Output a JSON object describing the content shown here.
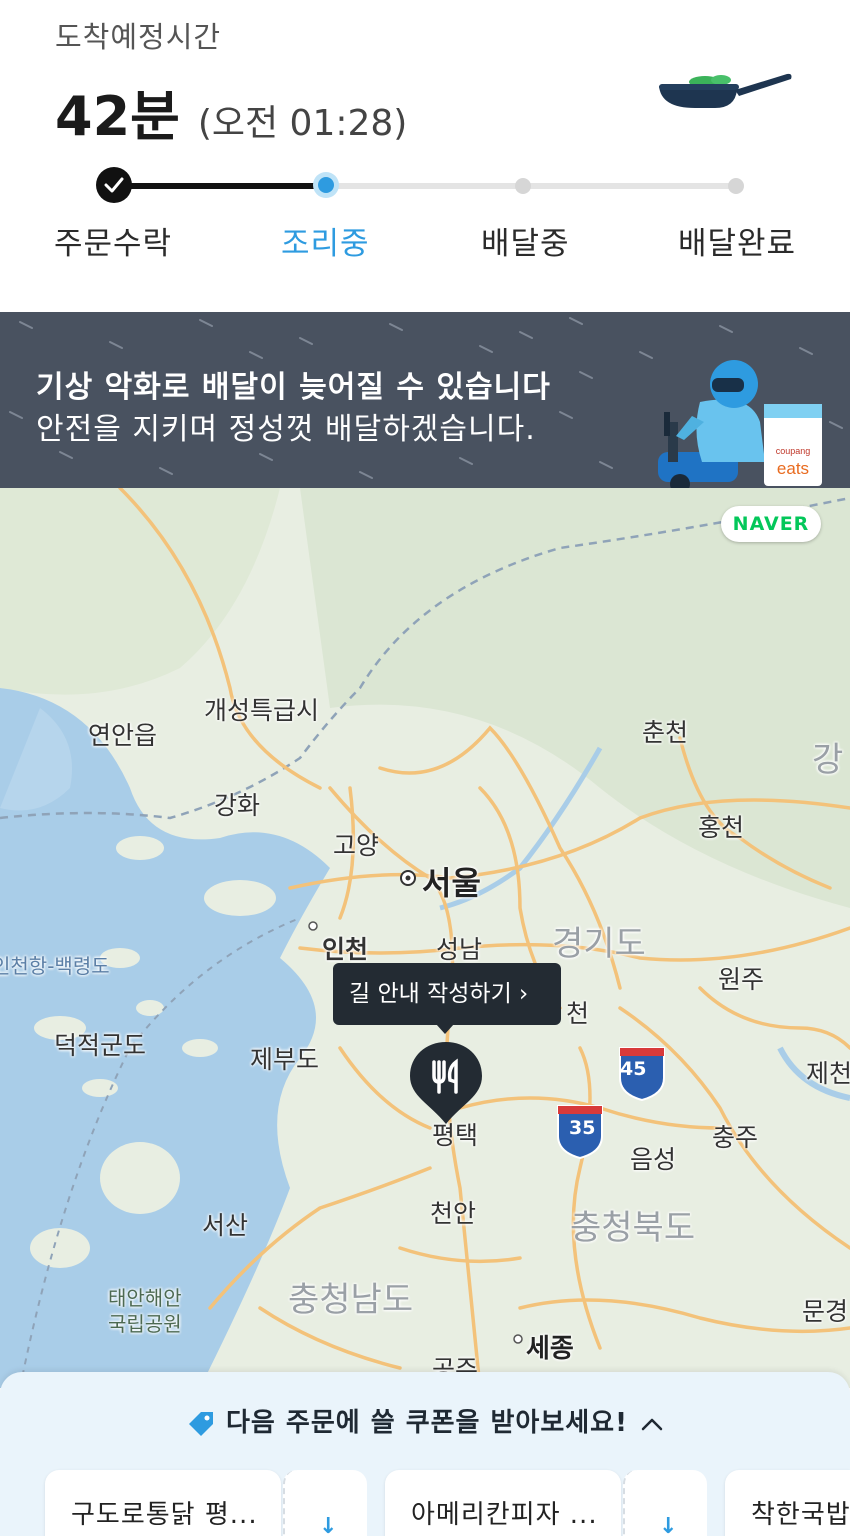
{
  "header": {
    "eta_label": "도착예정시간",
    "eta_minutes": "42분",
    "eta_clock": "(오전 01:28)"
  },
  "steps": [
    {
      "label": "주문수락",
      "state": "done"
    },
    {
      "label": "조리중",
      "state": "active"
    },
    {
      "label": "배달중",
      "state": "todo"
    },
    {
      "label": "배달완료",
      "state": "todo"
    }
  ],
  "banner": {
    "title": "기상 악화로 배달이 늦어질 수 있습니다",
    "subtitle": "안전을 지키며 정성껏 배달하겠습니다.",
    "logo_top": "coupang",
    "logo_bottom": "eats"
  },
  "map": {
    "provider_badge": "NAVER",
    "labels": {
      "gaesong": "개성특급시",
      "yeonan": "연안읍",
      "chuncheon": "춘천",
      "gang_edge": "강",
      "ganghwa": "강화",
      "hongcheon": "홍천",
      "goyang": "고양",
      "seoul": "서울",
      "incheon": "인천",
      "seongnam": "성남",
      "gyeonggi": "경기도",
      "wonju": "원주",
      "baengnyeong": "인천항-백령도",
      "cheon_partial": "천",
      "deokjeok": "덕적군도",
      "jebu": "제부도",
      "jecheon": "제천",
      "pyeongtaek": "평택",
      "chungju": "충주",
      "eumseong": "음성",
      "cheonan": "천안",
      "seosan": "서산",
      "chungbuk": "충청북도",
      "taean": "태안해안",
      "taean2": "국립공원",
      "chungnam": "충청남도",
      "mungyeong": "문경",
      "sejong": "세종",
      "gongju": "공주"
    },
    "highway_45": "45",
    "highway_35": "35",
    "tooltip": "길 안내 작성하기 ›",
    "pin_icon": "fork-knife-icon"
  },
  "coupons": {
    "heading": "다음 주문에 쓸 쿠폰을 받아보세요!",
    "items": [
      {
        "name": "구도로통닭 평..."
      },
      {
        "name": "아메리칸피자 ..."
      },
      {
        "name": "착한국밥"
      }
    ]
  },
  "colors": {
    "accent": "#2e9be0",
    "banner_bg": "#495260",
    "naver_green": "#03c75a",
    "sea": "#a9cde8",
    "road": "#f3c27a"
  }
}
